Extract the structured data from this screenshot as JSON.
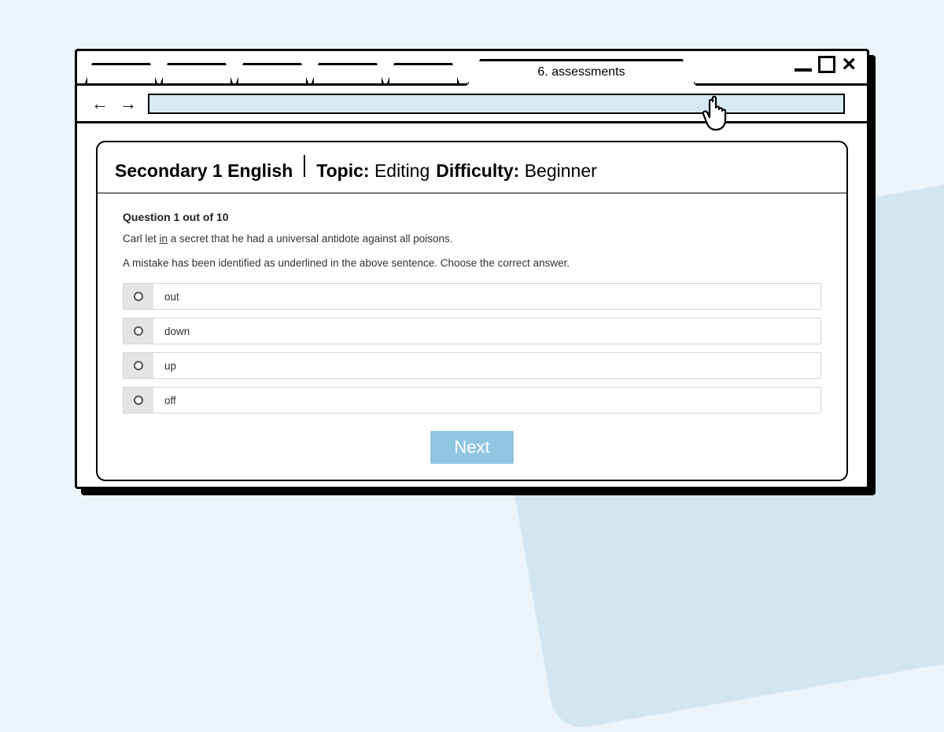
{
  "browser": {
    "active_tab_label": "6. assessments"
  },
  "header": {
    "course": "Secondary 1 English",
    "topic_label": "Topic:",
    "topic_value": "Editing",
    "difficulty_label": "Difficulty:",
    "difficulty_value": "Beginner"
  },
  "question": {
    "progress": "Question 1 out of 10",
    "sentence_pre": "Carl let ",
    "sentence_mistake": "in",
    "sentence_post": " a secret that he had a universal antidote against all poisons.",
    "instruction": "A mistake has been identified as underlined in the above sentence. Choose the correct answer.",
    "options": [
      "out",
      "down",
      "up",
      "off"
    ]
  },
  "buttons": {
    "next": "Next"
  }
}
